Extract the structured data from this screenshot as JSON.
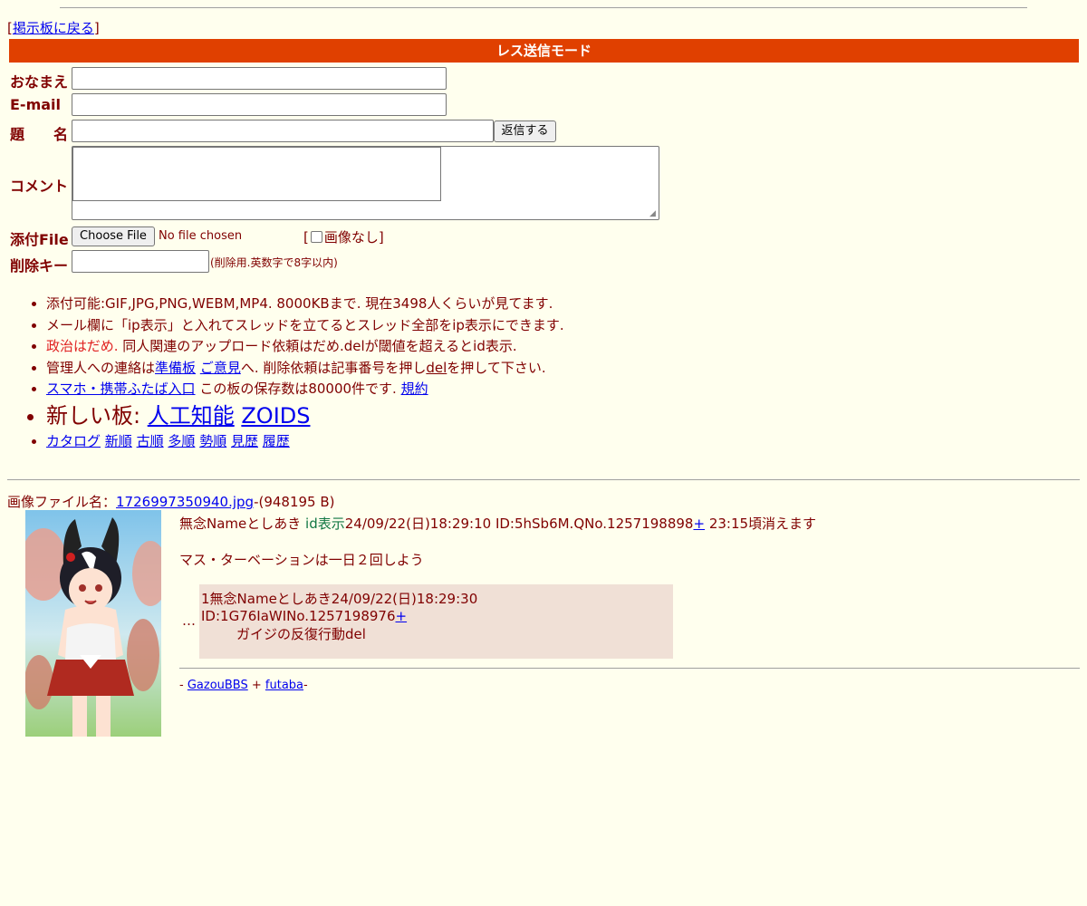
{
  "nav": {
    "back_open": "[",
    "back_label": "掲示板に戻る",
    "back_close": "]"
  },
  "mode_bar": {
    "title": "レス送信モード"
  },
  "form": {
    "name_label": "おなまえ",
    "email_label": "E-mail",
    "subject_label": "題　　名",
    "submit_label": "返信する",
    "comment_label": "コメント",
    "file_label": "添付File",
    "file_button": "Choose File",
    "file_status": "No file chosen",
    "noimg_open": "[",
    "noimg_label": "画像なし",
    "noimg_close": "]",
    "delkey_label": "削除キー",
    "delkey_hint": "(削除用.英数字で8字以内)"
  },
  "rules": {
    "r1": "添付可能:GIF,JPG,PNG,WEBM,MP4. 8000KBまで. 現在3498人くらいが見てます.",
    "r2": "メール欄に「ip表示」と入れてスレッドを立てるとスレッド全部をip表示にできます.",
    "r3_red": "政治はだめ.",
    "r3_rest": " 同人関連のアップロード依頼はだめ.delが閾値を超えるとid表示.",
    "r4_a": "管理人への連絡は",
    "r4_link1": "準備板",
    "r4_link2": "ご意見",
    "r4_b": "へ. 削除依頼は記事番号を押し",
    "r4_del": "del",
    "r4_c": "を押して下さい.",
    "r5_link": "スマホ・携帯ふたば入口",
    "r5_rest": " この板の保存数は80000件です. ",
    "r5_link2": "規約",
    "r6_text": "新しい板: ",
    "r6_link1": "人工知能",
    "r6_link2": "ZOIDS",
    "r7_links": [
      "カタログ",
      "新順",
      "古順",
      "多順",
      "勢順",
      "見歴",
      "履歴"
    ]
  },
  "thread": {
    "file_prefix": "画像ファイル名：",
    "file_name": "1726997350940.jpg",
    "file_size": "-(948195 B)",
    "head_a": "無念Nameとしあき ",
    "id_show": "id表示",
    "head_b": "24/09/22(日)18:29:10 ID:5hSb6M.QNo.1257198898",
    "plus": "+",
    "head_c": " 23:15頃消えます",
    "body": "マス・ターベーションは一日２回しよう",
    "ellipsis": "…",
    "reply": {
      "head": "1無念Nameとしあき24/09/22(日)18:29:30 ID:1G76IaWINo.1257198976",
      "plus": "+",
      "body": "ガイジの反復行動del"
    }
  },
  "footer": {
    "a": "- ",
    "link1": "GazouBBS",
    "b": " + ",
    "link2": "futaba",
    "c": "-"
  },
  "colors": {
    "background": "#ffffee",
    "text": "#800000",
    "mode_bar": "#e04000",
    "reply_bg": "#f0e0d6",
    "id_green": "#117743"
  }
}
